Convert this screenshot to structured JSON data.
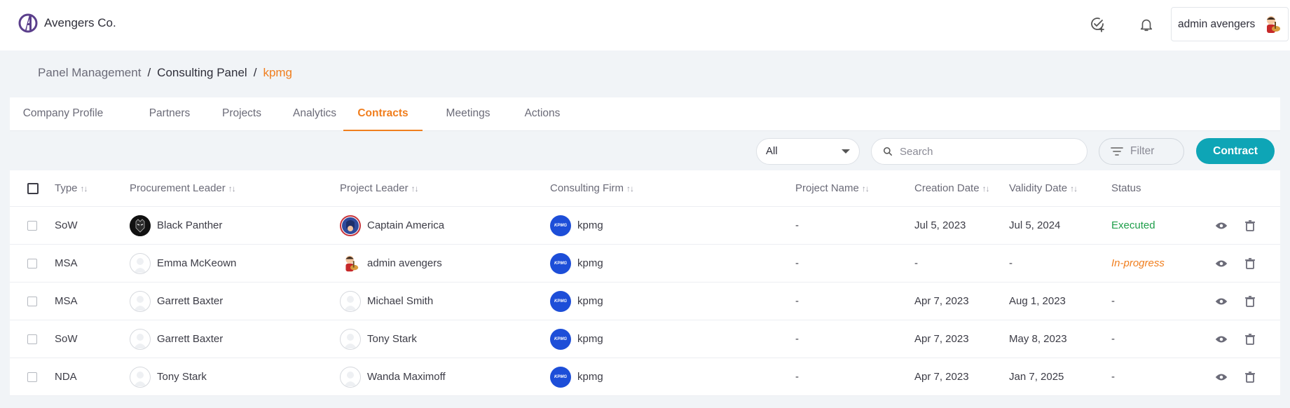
{
  "app": {
    "brand_name": "Avengers Co.",
    "user_name": "admin avengers"
  },
  "breadcrumb": [
    {
      "label": "Panel Management"
    },
    {
      "label": "Consulting Panel"
    },
    {
      "label": "kpmg"
    }
  ],
  "breadcrumb_separator": "/",
  "tabs": [
    {
      "label": "Company Profile",
      "active": false
    },
    {
      "label": "Partners",
      "active": false
    },
    {
      "label": "Projects",
      "active": false
    },
    {
      "label": "Analytics",
      "active": false
    },
    {
      "label": "Contracts",
      "active": true
    },
    {
      "label": "Meetings",
      "active": false
    },
    {
      "label": "Actions",
      "active": false
    }
  ],
  "toolbar": {
    "select_value": "All",
    "search_placeholder": "Search",
    "filter_label": "Filter",
    "contract_label": "Contract"
  },
  "table": {
    "columns": [
      "Type",
      "Procurement Leader",
      "Project Leader",
      "Consulting Firm",
      "Project Name",
      "Creation Date",
      "Validity Date",
      "Status"
    ],
    "sort_glyph": "↑↓",
    "rows": [
      {
        "type": "SoW",
        "procurement_leader": "Black Panther",
        "procurement_avatar": "panther",
        "project_leader": "Captain America",
        "project_avatar": "cap",
        "firm": "kpmg",
        "project_name": "-",
        "created": "Jul 5, 2023",
        "validity": "Jul 5, 2024",
        "status": "Executed",
        "status_kind": "executed"
      },
      {
        "type": "MSA",
        "procurement_leader": "Emma McKeown",
        "procurement_avatar": "blank",
        "project_leader": "admin avengers",
        "project_avatar": "admin",
        "firm": "kpmg",
        "project_name": "-",
        "created": "-",
        "validity": "-",
        "status": "In-progress",
        "status_kind": "progress"
      },
      {
        "type": "MSA",
        "procurement_leader": "Garrett Baxter",
        "procurement_avatar": "blank",
        "project_leader": "Michael Smith",
        "project_avatar": "blank",
        "firm": "kpmg",
        "project_name": "-",
        "created": "Apr 7, 2023",
        "validity": "Aug 1, 2023",
        "status": "-",
        "status_kind": "none"
      },
      {
        "type": "SoW",
        "procurement_leader": "Garrett Baxter",
        "procurement_avatar": "blank",
        "project_leader": "Tony Stark",
        "project_avatar": "blank",
        "firm": "kpmg",
        "project_name": "-",
        "created": "Apr 7, 2023",
        "validity": "May 8, 2023",
        "status": "-",
        "status_kind": "none"
      },
      {
        "type": "NDA",
        "procurement_leader": "Tony Stark",
        "procurement_avatar": "blank",
        "project_leader": "Wanda Maximoff",
        "project_avatar": "blank",
        "firm": "kpmg",
        "project_name": "-",
        "created": "Apr 7, 2023",
        "validity": "Jan 7, 2025",
        "status": "-",
        "status_kind": "none"
      }
    ]
  },
  "icons": {
    "topbar": [
      "task-check-icon",
      "bell-icon"
    ],
    "row_actions": [
      "eye-icon",
      "trash-icon"
    ]
  },
  "colors": {
    "accent_orange": "#f07e1e",
    "primary_teal": "#0ea5b6",
    "status_executed": "#1e9e4a",
    "kpmg_blue": "#1d4ed8"
  }
}
